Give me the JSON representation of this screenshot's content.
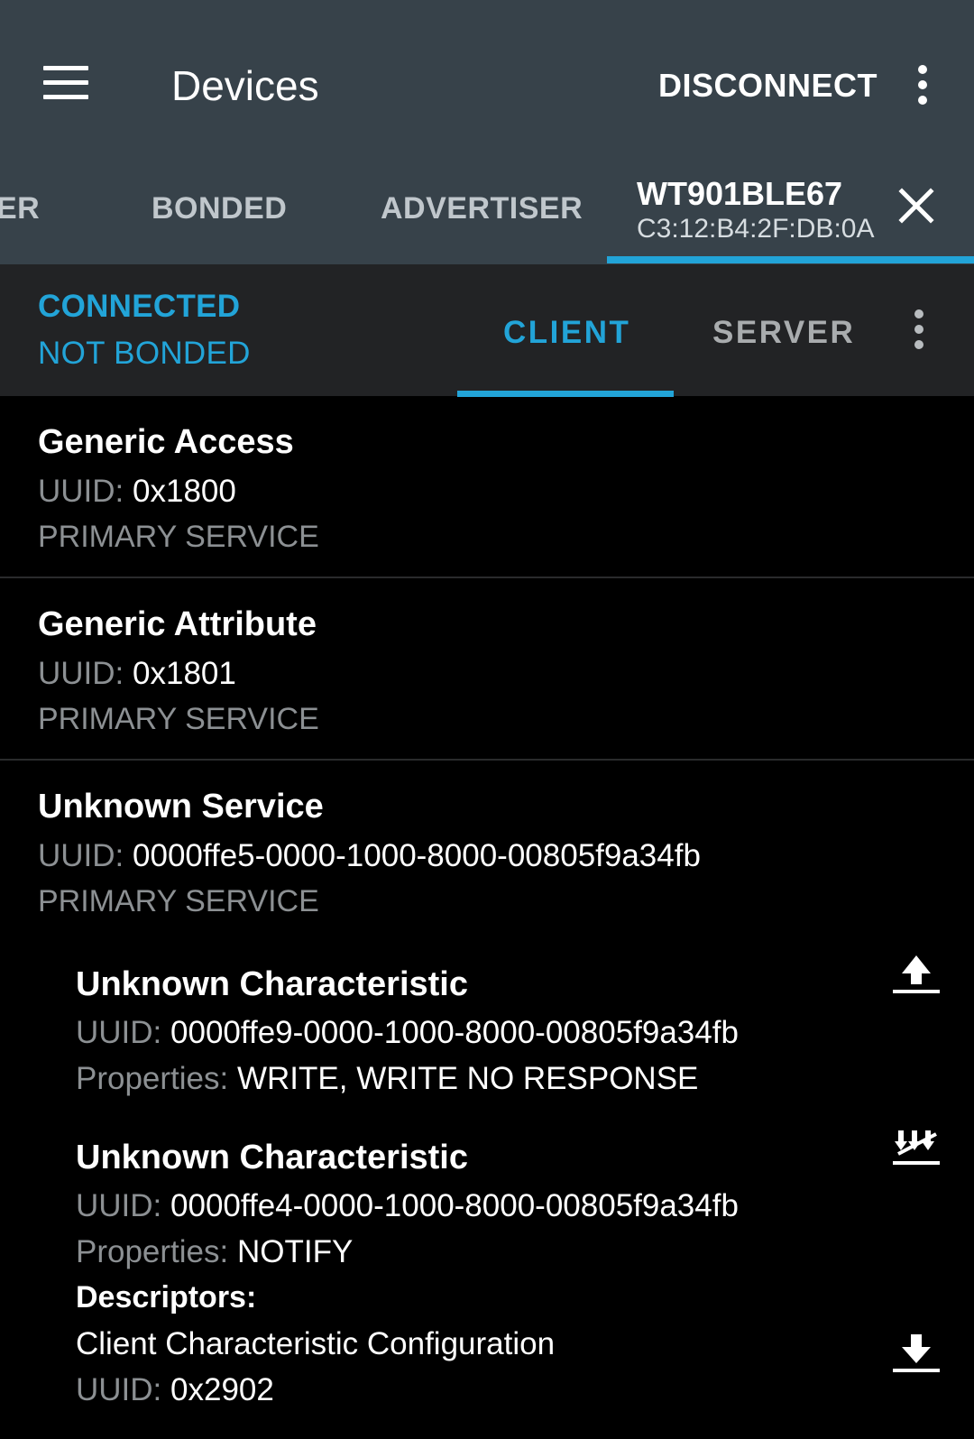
{
  "appbar": {
    "title": "Devices",
    "disconnect_label": "DISCONNECT"
  },
  "device_tabs": [
    {
      "label": "ER"
    },
    {
      "label": "BONDED"
    },
    {
      "label": "ADVERTISER"
    },
    {
      "name": "WT901BLE67",
      "mac": "C3:12:B4:2F:DB:0A"
    }
  ],
  "status": {
    "connection": "CONNECTED",
    "bond": "NOT BONDED"
  },
  "sub_tabs": [
    {
      "label": "CLIENT"
    },
    {
      "label": "SERVER"
    }
  ],
  "labels": {
    "uuid": "UUID:",
    "properties": "Properties:",
    "descriptors": "Descriptors:"
  },
  "services": [
    {
      "name": "Generic Access",
      "uuid": "0x1800",
      "type": "PRIMARY SERVICE"
    },
    {
      "name": "Generic Attribute",
      "uuid": "0x1801",
      "type": "PRIMARY SERVICE"
    },
    {
      "name": "Unknown Service",
      "uuid": "0000ffe5-0000-1000-8000-00805f9a34fb",
      "type": "PRIMARY SERVICE",
      "characteristics": [
        {
          "name": "Unknown Characteristic",
          "uuid": "0000ffe9-0000-1000-8000-00805f9a34fb",
          "properties": "WRITE, WRITE NO RESPONSE"
        },
        {
          "name": "Unknown Characteristic",
          "uuid": "0000ffe4-0000-1000-8000-00805f9a34fb",
          "properties": "NOTIFY",
          "descriptor": {
            "name": "Client Characteristic Configuration",
            "uuid": "0x2902"
          }
        }
      ]
    }
  ],
  "colors": {
    "appbar": "#37424a",
    "subbar": "#222325",
    "accent": "#22a4d8",
    "background": "#000000"
  }
}
